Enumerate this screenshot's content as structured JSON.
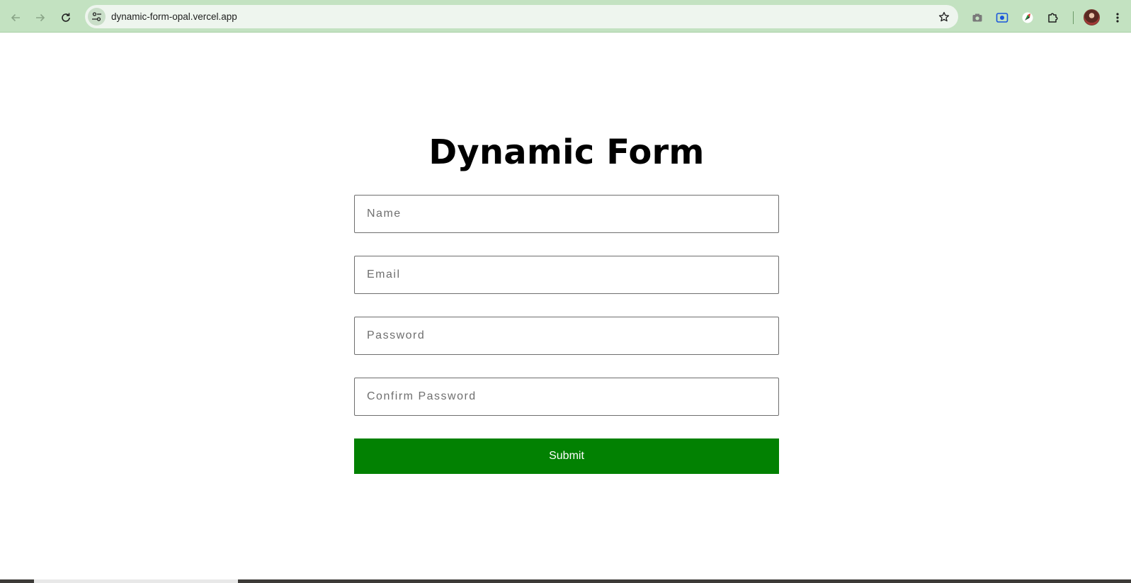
{
  "browser": {
    "url": "dynamic-form-opal.vercel.app",
    "nav": {
      "back": "back-arrow-icon",
      "forward": "forward-arrow-icon",
      "reload": "reload-icon"
    },
    "colors": {
      "toolbar": "#c3e2c1",
      "omnibox": "#eef5ee"
    }
  },
  "page": {
    "title": "Dynamic Form",
    "fields": [
      {
        "name": "name",
        "placeholder": "Name",
        "value": ""
      },
      {
        "name": "email",
        "placeholder": "Email",
        "value": ""
      },
      {
        "name": "password",
        "placeholder": "Password",
        "value": ""
      },
      {
        "name": "confirm-password",
        "placeholder": "Confirm Password",
        "value": ""
      }
    ],
    "submit_label": "Submit",
    "colors": {
      "submit_bg": "#028102",
      "submit_text": "#ffffff"
    }
  }
}
